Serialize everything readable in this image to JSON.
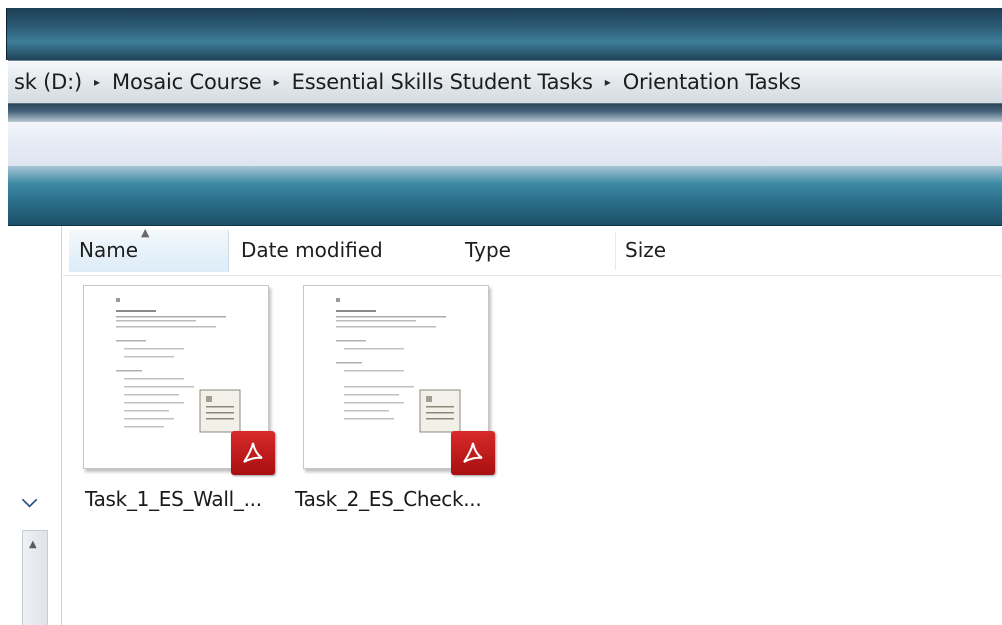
{
  "breadcrumb": {
    "items": [
      "sk (D:)",
      "Mosaic Course",
      "Essential Skills Student Tasks",
      "Orientation Tasks"
    ],
    "separator": "▸"
  },
  "columns": {
    "name": "Name",
    "date_modified": "Date modified",
    "type": "Type",
    "size": "Size"
  },
  "files": [
    {
      "name": "Task_1_ES_Wall_...",
      "icon": "pdf-icon"
    },
    {
      "name": "Task_2_ES_Check...",
      "icon": "pdf-icon"
    }
  ],
  "nav": {
    "expand_icon": "chevron-down-icon",
    "scroll_icon": "scroll-up-icon"
  },
  "colors": {
    "toolbar": "#2b6f8a",
    "pdf_badge": "#c41b1b",
    "header_selected": "#dcecf7"
  }
}
